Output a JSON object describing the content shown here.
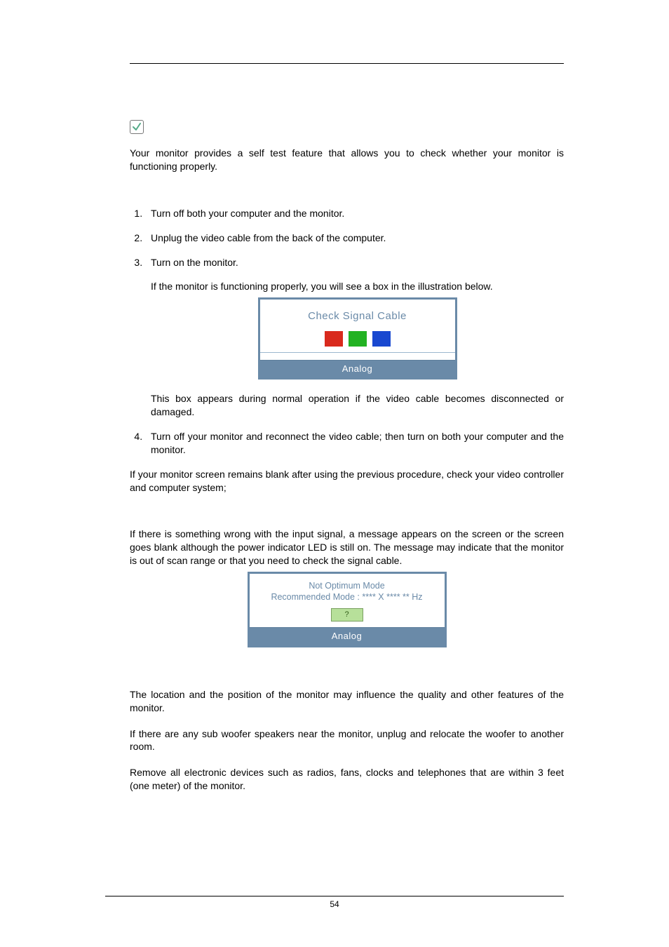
{
  "note_icon": "note-icon",
  "intro": "Your monitor provides a self test feature that allows you to check whether your monitor is functioning properly.",
  "steps": {
    "s1": "Turn off both your computer and the monitor.",
    "s2": "Unplug the video cable from the back of the computer.",
    "s3": "Turn on the monitor.",
    "s3_note": "If the monitor is functioning properly, you will see a box in the illustration below.",
    "s3_after": "This box appears during normal operation if the video cable becomes disconnected or damaged.",
    "s4": "Turn off your monitor and reconnect the video cable; then turn on both your computer and the monitor."
  },
  "fig1": {
    "title": "Check Signal Cable",
    "footer": "Analog"
  },
  "after_steps": "If your monitor screen remains blank after using the previous procedure, check your video controller and computer system;",
  "warning_para": "If there is something wrong with the input signal, a message appears on the screen or the screen goes blank although the power indicator LED is still on. The message may indicate that the monitor is out of scan range or that you need to check the signal cable.",
  "fig2": {
    "line1": "Not Optimum Mode",
    "line2": "Recommended Mode : **** X **** ** Hz",
    "btn": "?",
    "footer": "Analog"
  },
  "env_p1": "The location and the position of the monitor may influence the quality and other features of the monitor.",
  "env_p2": "If there are any sub woofer speakers near the monitor, unplug and relocate the woofer to another room.",
  "env_p3": "Remove all electronic devices such as radios, fans, clocks and telephones that are within 3 feet (one meter) of the monitor.",
  "page_number": "54"
}
